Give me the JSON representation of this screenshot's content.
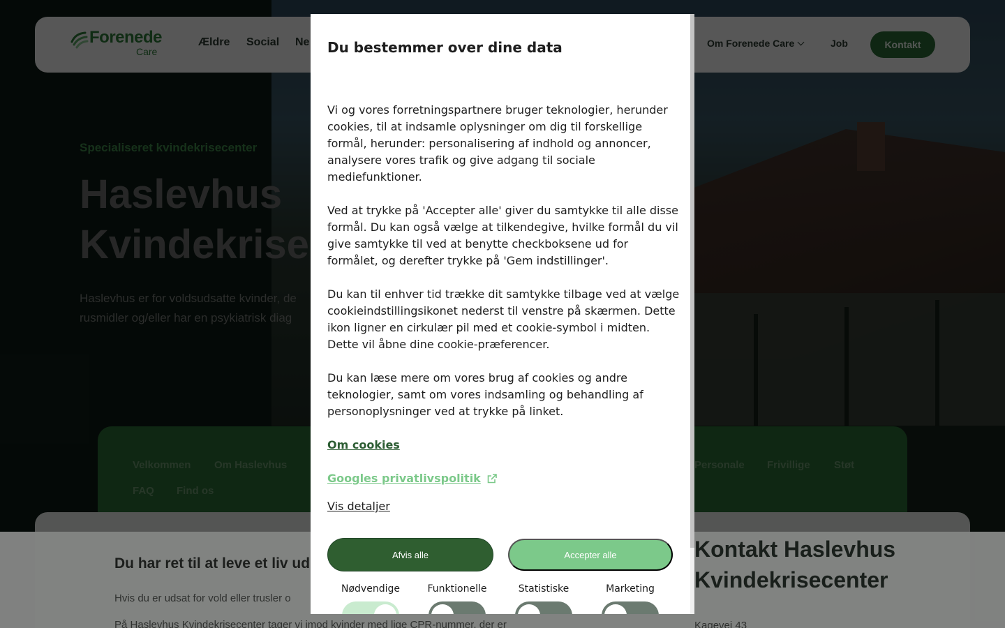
{
  "nav": {
    "logo_main": "Forenede",
    "logo_sub": "Care",
    "items": [
      "Ældre",
      "Social",
      "Ne"
    ],
    "om": "Om Forenede Care",
    "job": "Job",
    "kontakt": "Kontakt"
  },
  "hero": {
    "kicker": "Specialiseret kvindekrisecenter",
    "title_line1": "Haslevhus",
    "title_line2": "Kvindekrisece",
    "desc_line1": "Haslevhus er for voldsudsatte kvinder, de",
    "desc_line2": "rusmidler og/eller har en psykiatrisk diag"
  },
  "subnav": {
    "items": [
      "Velkommen",
      "Om Haslevhus",
      "Personale",
      "Frivillige",
      "Støt",
      "FAQ",
      "Find os"
    ]
  },
  "content": {
    "heading": "Du har ret til at leve et liv ud",
    "para1": "Hvis du er udsat for vold eller trusler o",
    "para2": "På Haslevhus Kvindekrisecenter tager vi imod kvinder med lige CPR-nummer, der er",
    "contact_title": "Kontakt Haslevhus Kvindekrisecenter",
    "contact_addr": "Kagevej 43"
  },
  "modal": {
    "title": "Du bestemmer over dine data",
    "paragraphs": [
      "Vi og vores forretningspartnere bruger teknologier, herunder cookies, til at indsamle oplysninger om dig til forskellige formål, herunder: personalisering af indhold og annoncer, analysere vores trafik og give adgang til sociale mediefunktioner.",
      "Ved at trykke på 'Accepter alle' giver du samtykke til alle disse formål. Du kan også vælge at tilkendegive, hvilke formål du vil give samtykke til ved at benytte checkboksene ud for formålet, og derefter trykke på 'Gem indstillinger'.",
      "Du kan til enhver tid trække dit samtykke tilbage ved at vælge cookieindstillingsikonet nederst til venstre på skærmen. Dette ikon ligner en cirkulær pil med et cookie-symbol i midten. Dette vil åbne dine cookie-præferencer.",
      "Du kan læse mere om vores brug af cookies og andre teknologier, samt om vores indsamling og behandling af personoplysninger ved at trykke på linket."
    ],
    "link_cookies": "Om cookies",
    "link_google": "Googles privatlivspolitik",
    "link_details": "Vis detaljer",
    "btn_reject": "Afvis alle",
    "btn_accept": "Accepter alle",
    "categories": [
      {
        "label": "Nødvendige",
        "on": true
      },
      {
        "label": "Funktionelle",
        "on": false
      },
      {
        "label": "Statistiske",
        "on": false
      },
      {
        "label": "Marketing",
        "on": false
      }
    ]
  },
  "colors": {
    "brand_green": "#2d6b37",
    "accept_green": "#7cc98a",
    "reject_green": "#2f5e30"
  }
}
